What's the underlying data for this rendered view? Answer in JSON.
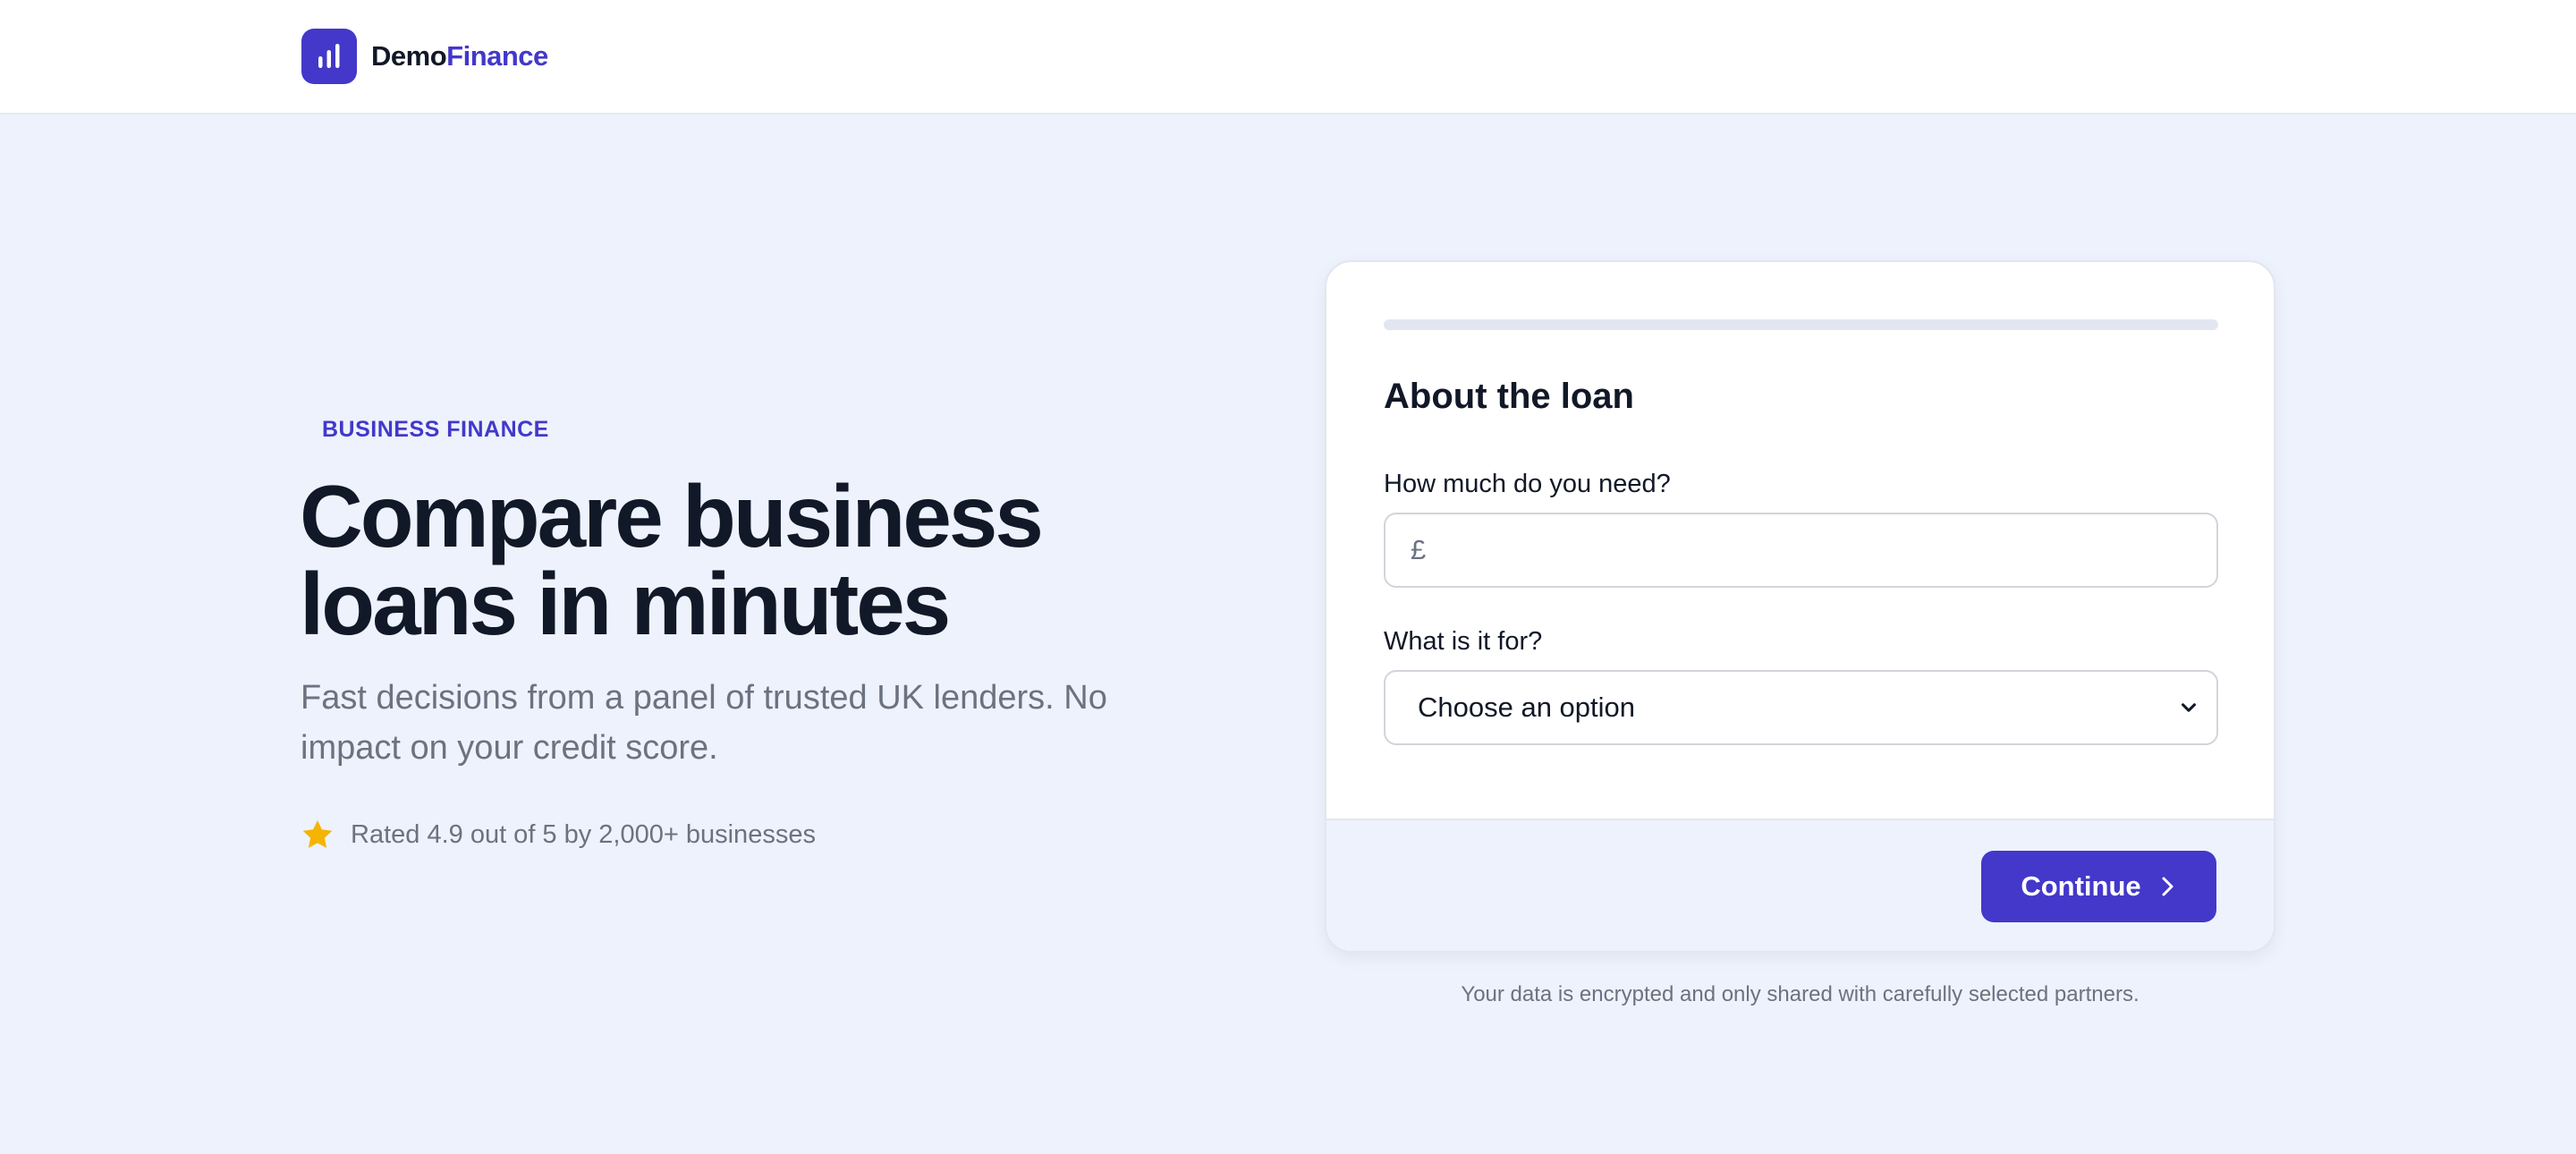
{
  "header": {
    "logo_icon": "bar-chart-icon",
    "logo_text_part1": "Demo",
    "logo_text_part2": "Finance"
  },
  "hero": {
    "eyebrow": "BUSINESS FINANCE",
    "title_line1": "Compare business",
    "title_line2": "loans in minutes",
    "subtitle": "Fast decisions from a panel of trusted UK lenders. No impact on your credit score.",
    "rating_icon": "star-icon",
    "rating_text": "Rated 4.9 out of 5 by 2,000+ businesses"
  },
  "form": {
    "progress": 0,
    "title": "About the loan",
    "amount_label": "How much do you need?",
    "currency_symbol": "£",
    "amount_value": "",
    "purpose_label": "What is it for?",
    "purpose_selected": "Choose an option",
    "continue_label": "Continue"
  },
  "footnote": "Your data is encrypted and only shared with carefully selected partners.",
  "colors": {
    "brand": "#4338ca",
    "background": "#eef2fd",
    "star": "#f5b400",
    "text_dark": "#111827",
    "text_muted": "#6b7280"
  }
}
